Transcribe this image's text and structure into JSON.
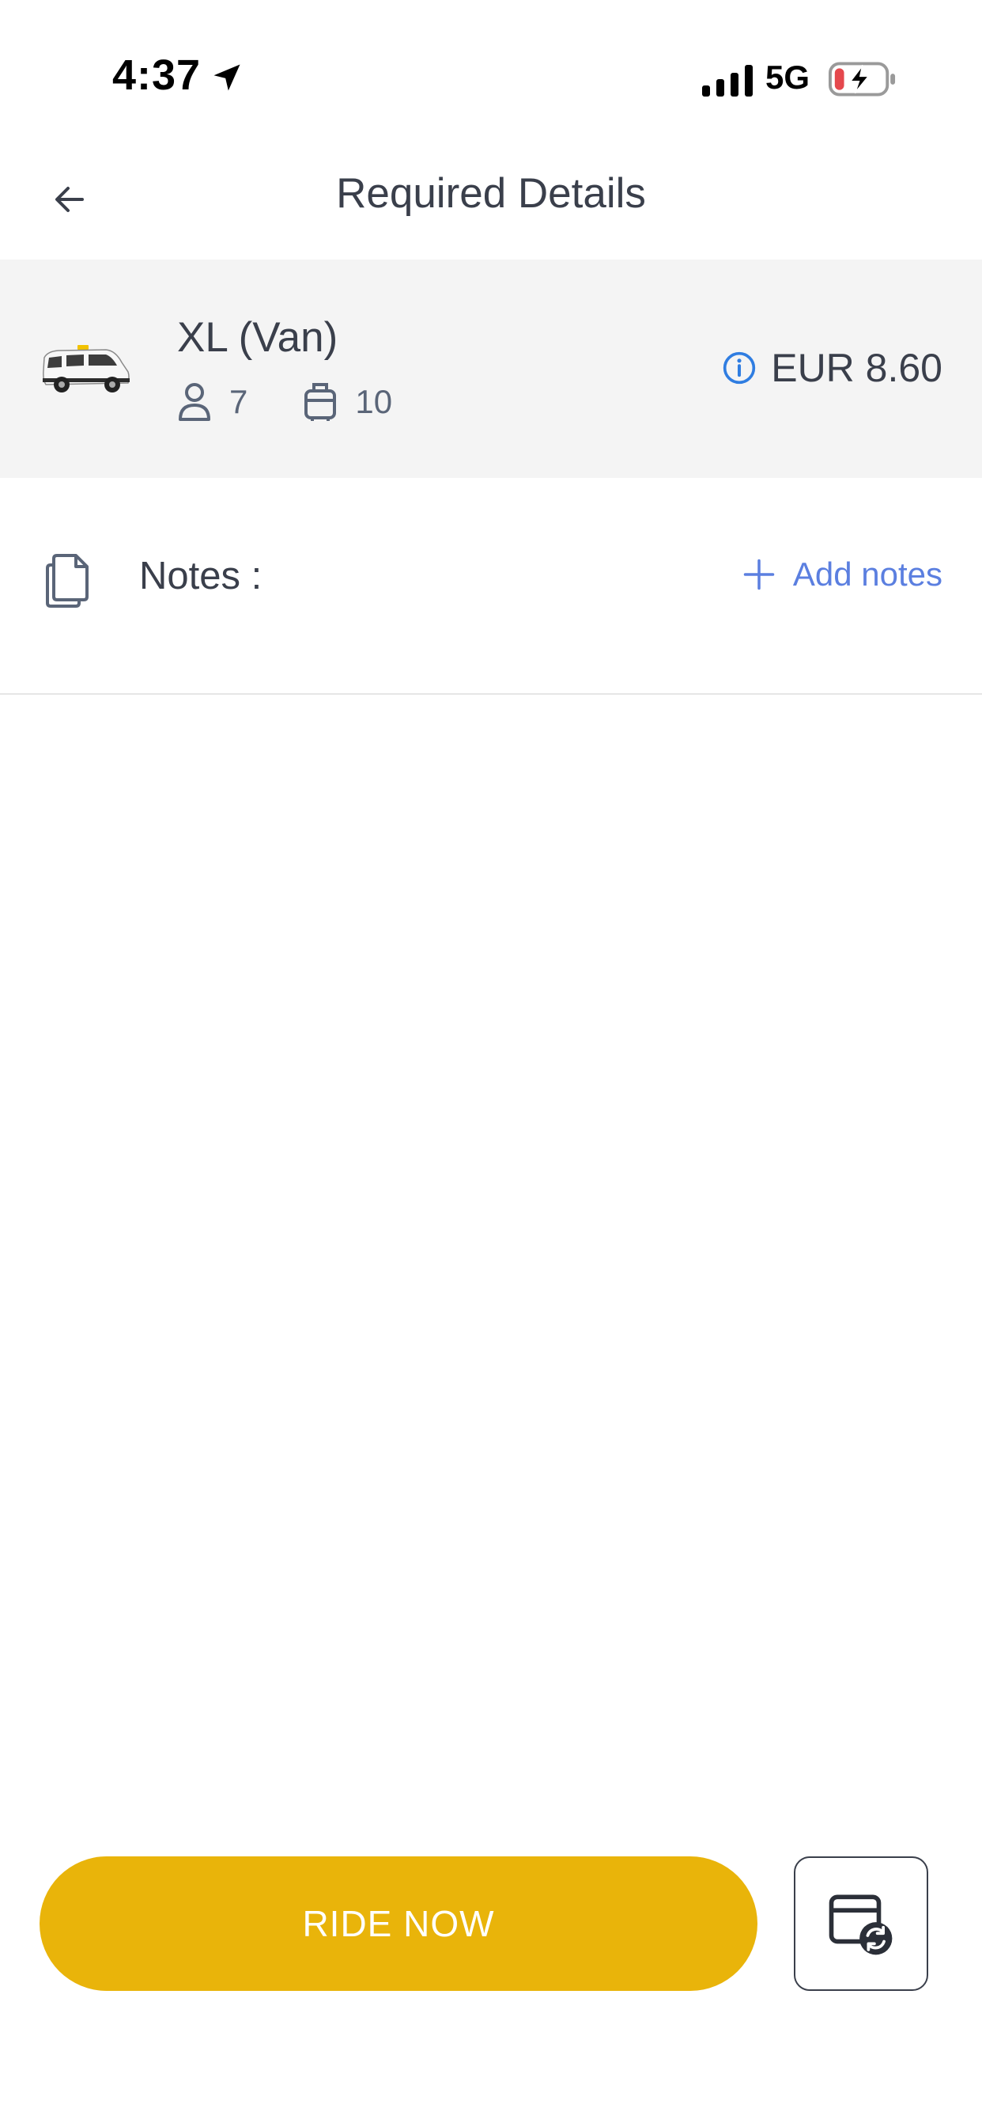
{
  "status_bar": {
    "time": "4:37",
    "network": "5G",
    "icons": [
      "location-arrow-icon",
      "signal-icon",
      "battery-charging-icon"
    ]
  },
  "header": {
    "title": "Required Details",
    "back_icon": "back-arrow-icon"
  },
  "vehicle": {
    "name": "XL (Van)",
    "image_icon": "van-icon",
    "passengers": "7",
    "luggage": "10",
    "fare": "EUR 8.60",
    "info_icon": "info-icon"
  },
  "notes": {
    "label": "Notes :",
    "add_label": "Add notes",
    "icon": "document-icon"
  },
  "actions": {
    "ride_now_label": "RIDE NOW",
    "schedule_icon": "schedule-icon"
  },
  "colors": {
    "accent": "#e9b40a",
    "link": "#5b7fe0",
    "info": "#2f7de1",
    "card_bg": "#f4f4f4",
    "text": "#3a3f4b"
  }
}
